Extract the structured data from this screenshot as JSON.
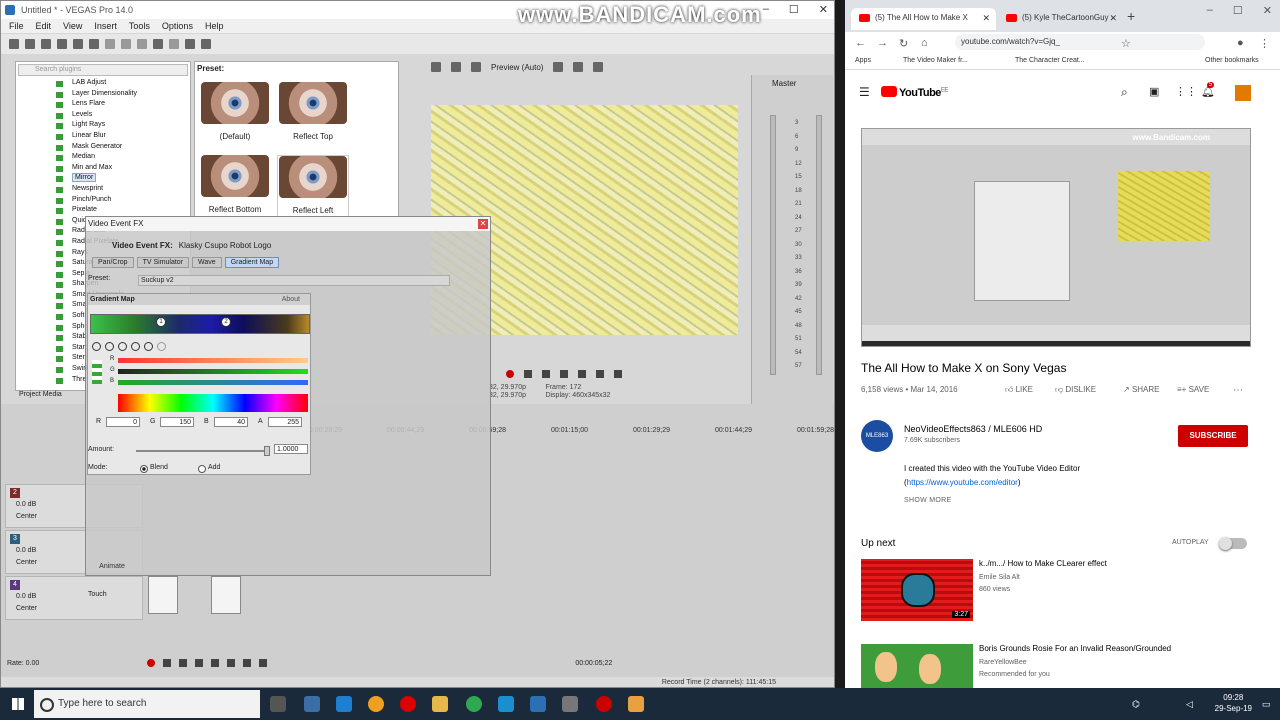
{
  "vegas": {
    "title": "Untitled * - VEGAS Pro 14.0",
    "menu": [
      "File",
      "Edit",
      "View",
      "Insert",
      "Tools",
      "Options",
      "Help"
    ],
    "search_placeholder": "Search plugins",
    "plugins": [
      "LAB Adjust",
      "Layer Dimensionality",
      "Lens Flare",
      "Levels",
      "Light Rays",
      "Linear Blur",
      "Mask Generator",
      "Median",
      "Min and Max",
      "Mirror",
      "Newsprint",
      "Pinch/Punch",
      "Pixelate",
      "Quick Blur",
      "Radial Blur",
      "Radial Pixelate",
      "Rays",
      "Saturation Adjust",
      "Sepia",
      "Sharpen",
      "Smart Upsample",
      "Smart Zoom",
      "Soft Contrast",
      "Spherize",
      "Stabilize",
      "Starburst",
      "Stereoscopic 3D",
      "Swirl",
      "Threshold"
    ],
    "selected_plugin": "Mirror",
    "preset_header": "Preset:",
    "presets": [
      "(Default)",
      "Reflect Top",
      "Reflect Bottom",
      "Reflect Left"
    ],
    "preview_label": "Preview (Auto)",
    "master_label": "Master",
    "project_media": "Project Media",
    "preview_info": {
      "line1": "32, 29.970p",
      "line2": "32, 29.970p",
      "frame_label": "Frame:",
      "frame": "172",
      "display_label": "Display:",
      "display": "460x345x32"
    },
    "db_scale": [
      "3",
      "6",
      "9",
      "12",
      "15",
      "18",
      "21",
      "24",
      "27",
      "30",
      "33",
      "36",
      "39",
      "42",
      "45",
      "48",
      "51",
      "54",
      "57"
    ],
    "ruler": [
      "00:00:00;00",
      "00:00:14;29",
      "00:00:29;29",
      "00:00:44;29",
      "00:00:59;28",
      "00:01:15;00",
      "00:01:29;29",
      "00:01:44;29",
      "00:01:59;28"
    ],
    "track_vol": "0.0 dB",
    "track_pan": "Center",
    "touch": "Touch",
    "rate": "Rate: 0.00",
    "timecode": "00:00:05;22",
    "record_time": "Record Time (2 channels): 111:45:15",
    "animate": "Animate"
  },
  "fx": {
    "title": "Video Event FX",
    "chain_label": "Video Event FX:",
    "chain_name": "Klasky Csupo Robot Logo",
    "chain": [
      "Pan/Crop",
      "TV Simulator",
      "Wave",
      "Gradient Map"
    ],
    "preset_label": "Preset:",
    "preset_value": "Suckup v2",
    "panel_title": "Gradient Map",
    "about": "About",
    "stops": [
      "1",
      "2"
    ],
    "r_label": "R",
    "g_label": "G",
    "b_label": "B",
    "a_label": "A",
    "r": "0",
    "g": "150",
    "b": "40",
    "a": "255",
    "amount_label": "Amount:",
    "amount": "1.0000",
    "mode_label": "Mode:",
    "mode_blend": "Blend",
    "mode_add": "Add"
  },
  "bandicam": {
    "watermark": "www.BANDICAM.com",
    "resolution": "1920x1080"
  },
  "chrome": {
    "tabs": [
      "(5) The All How to Make X",
      "(5) Kyle TheCartoonGuy"
    ],
    "url": "youtube.com/watch?v=Gjq_",
    "bookmarks": [
      "Apps",
      "The Video Maker fr...",
      "The Character Creat...",
      "Other bookmarks"
    ],
    "notif_count": "5"
  },
  "youtube": {
    "logo": "YouTube",
    "region": "EE",
    "video_watermark": "www.Bandicam.com",
    "title": "The All How to Make X on Sony Vegas",
    "meta": "6,158 views • Mar 14, 2016",
    "like": "LIKE",
    "dislike": "DISLIKE",
    "share": "SHARE",
    "save": "SAVE",
    "channel_avatar_text": "MLE863",
    "channel": "NeoVideoEffects863 / MLE606 HD",
    "subscribers": "7.69K subscribers",
    "subscribe": "SUBSCRIBE",
    "desc_line1": "I created this video with the YouTube Video Editor",
    "desc_line2_pre": "(",
    "desc_link": "https://www.youtube.com/editor",
    "desc_line2_post": ")",
    "show_more": "SHOW MORE",
    "up_next": "Up next",
    "autoplay": "AUTOPLAY",
    "next_videos": [
      {
        "title": "k../m.../ How to Make CLearer effect",
        "channel": "Emile Sila Alt",
        "views": "860 views",
        "duration": "3:27"
      },
      {
        "title": "Boris Grounds Rosie For an Invalid Reason/Grounded",
        "channel": "RareYellowBee",
        "views": "Recommended for you"
      }
    ]
  },
  "taskbar": {
    "search_placeholder": "Type here to search",
    "time": "09:28",
    "date": "29-Sep-19"
  }
}
